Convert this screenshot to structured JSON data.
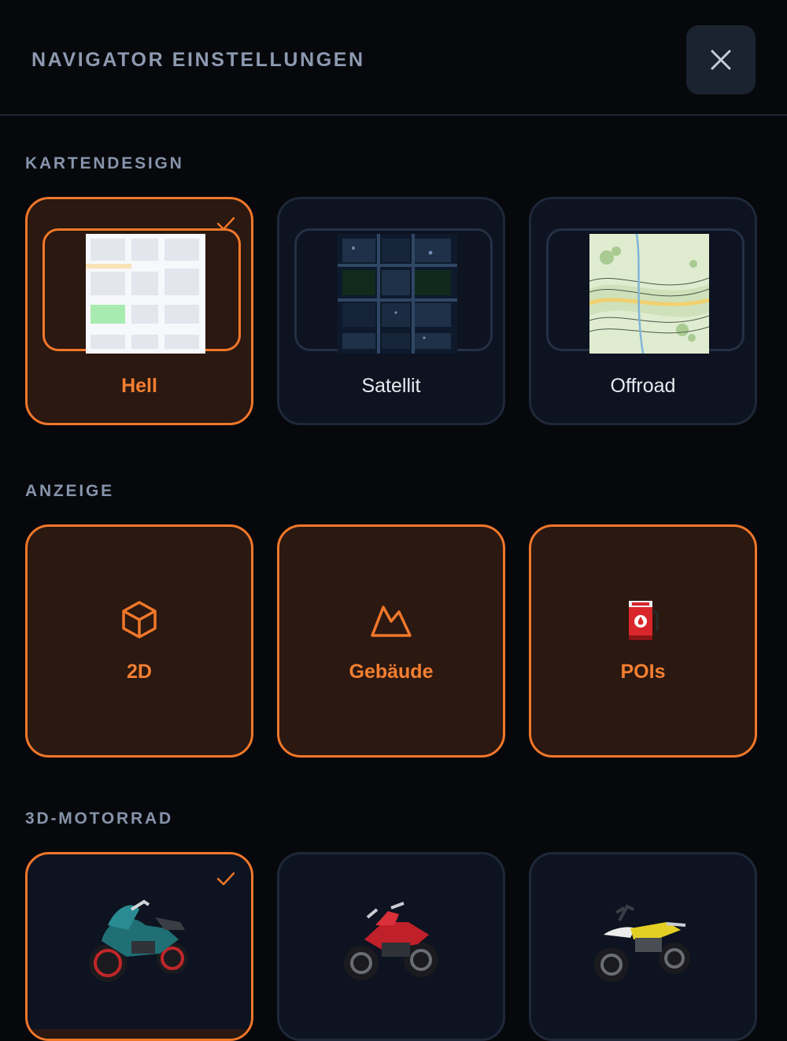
{
  "header": {
    "title": "NAVIGATOR EINSTELLUNGEN",
    "close_icon": "close-icon"
  },
  "sections": {
    "map_design": {
      "label": "KARTENDESIGN",
      "options": [
        {
          "label": "Hell",
          "selected": true
        },
        {
          "label": "Satellit",
          "selected": false
        },
        {
          "label": "Offroad",
          "selected": false
        }
      ]
    },
    "display": {
      "label": "ANZEIGE",
      "options": [
        {
          "label": "2D",
          "icon": "cube-icon",
          "active": true
        },
        {
          "label": "Gebäude",
          "icon": "mountain-icon",
          "active": true
        },
        {
          "label": "POIs",
          "icon": "fuel-pump-icon",
          "active": true
        }
      ]
    },
    "motorcycle": {
      "label": "3D-MOTORRAD",
      "options": [
        {
          "name": "sport-bike",
          "color": "#1f6f75",
          "selected": true
        },
        {
          "name": "naked-bike",
          "color": "#c0202a",
          "selected": false
        },
        {
          "name": "enduro-bike",
          "color": "#e3d024",
          "selected": false
        }
      ]
    }
  },
  "colors": {
    "accent": "#f0772a",
    "background": "#07080c",
    "tile": "#0d1320",
    "tile_active": "#2b1810"
  }
}
